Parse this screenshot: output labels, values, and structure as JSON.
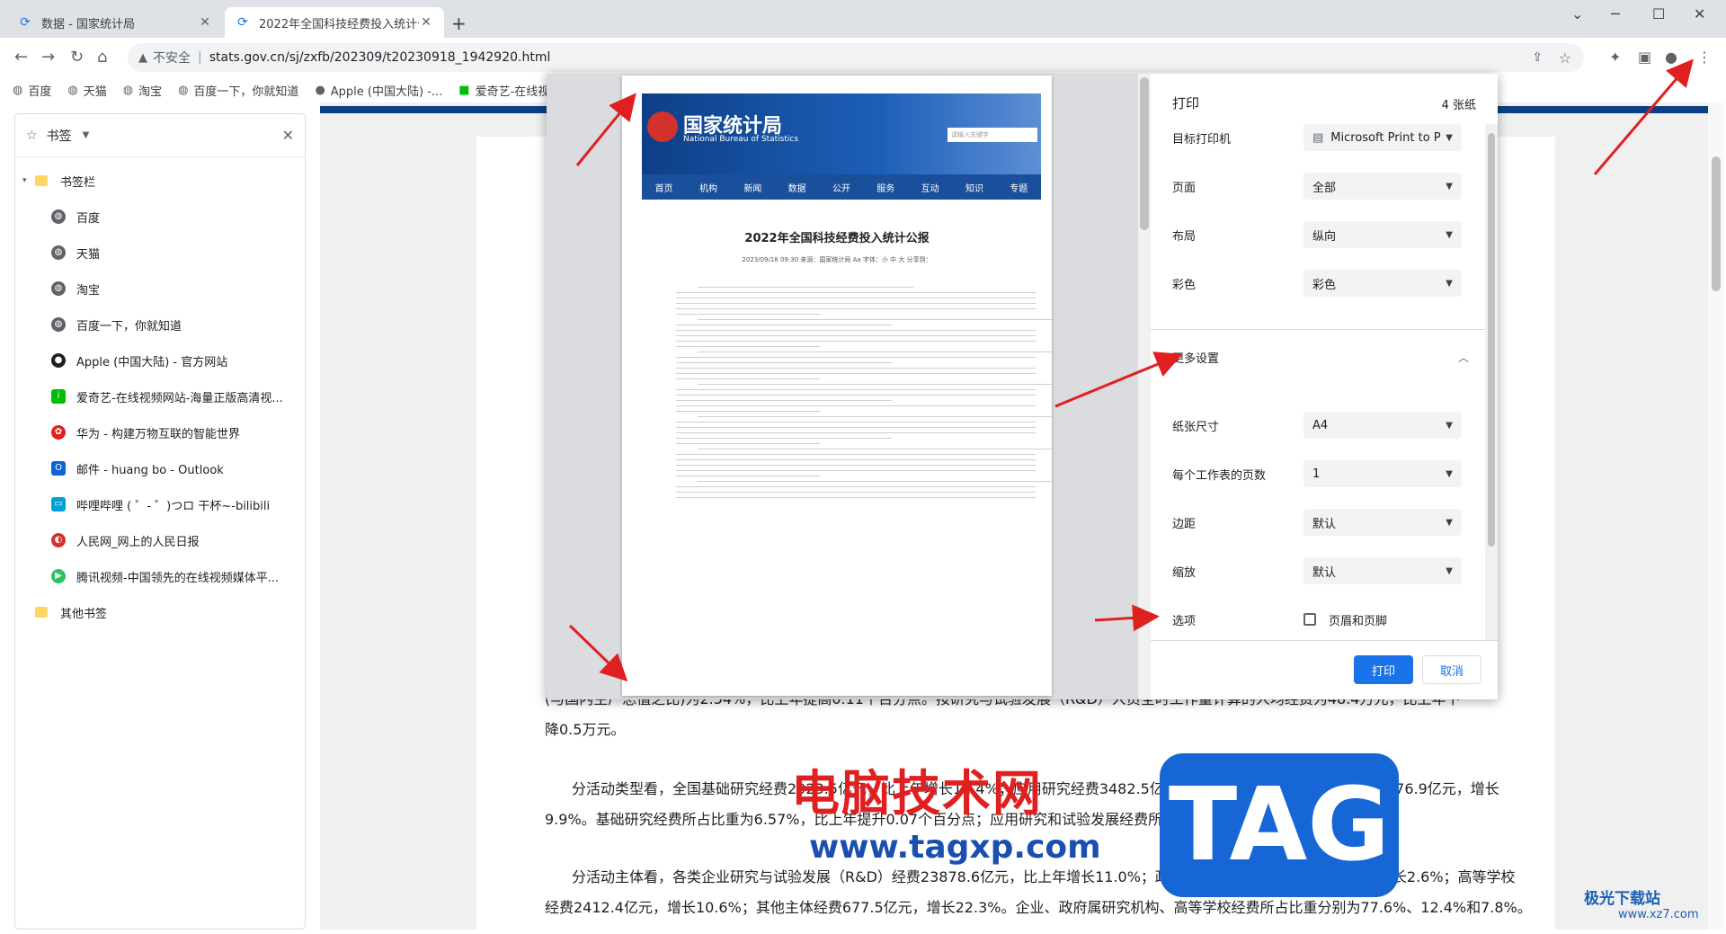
{
  "tabs": [
    {
      "title": "数据 - 国家统计局",
      "active": false
    },
    {
      "title": "2022年全国科技经费投入统计公",
      "active": true
    }
  ],
  "address": {
    "security": "不安全",
    "url": "stats.gov.cn/sj/zxfb/202309/t20230918_1942920.html"
  },
  "bookmarks_bar": [
    "百度",
    "天猫",
    "淘宝",
    "百度一下，你就知道",
    "Apple (中国大陆) -...",
    "爱奇艺-在线视"
  ],
  "side_panel": {
    "title": "书签",
    "root": "书签栏",
    "items": [
      {
        "label": "百度",
        "icon": "globe-icon",
        "color": "#5f6368"
      },
      {
        "label": "天猫",
        "icon": "globe-icon",
        "color": "#5f6368"
      },
      {
        "label": "淘宝",
        "icon": "globe-icon",
        "color": "#5f6368"
      },
      {
        "label": "百度一下，你就知道",
        "icon": "globe-icon",
        "color": "#5f6368"
      },
      {
        "label": "Apple (中国大陆) - 官方网站",
        "icon": "apple-icon",
        "color": "#202124"
      },
      {
        "label": "爱奇艺-在线视频网站-海量正版高清视...",
        "icon": "iqiyi-icon",
        "color": "#00be06"
      },
      {
        "label": "华为 - 构建万物互联的智能世界",
        "icon": "huawei-icon",
        "color": "#e02020"
      },
      {
        "label": "邮件 - huang bo - Outlook",
        "icon": "outlook-icon",
        "color": "#0a64d2"
      },
      {
        "label": "哔哩哔哩 ( ゜- ゜)つロ 干杯~-bilibili",
        "icon": "bilibili-icon",
        "color": "#00a1d6"
      },
      {
        "label": "人民网_网上的人民日报",
        "icon": "people-icon",
        "color": "#d4302c"
      },
      {
        "label": "腾讯视频-中国领先的在线视频媒体平...",
        "icon": "tencent-video-icon",
        "color": "#2cc35c"
      }
    ],
    "other": "其他书签"
  },
  "page_text": [
    "(与国内生产总值之比)为2.54%，比上年提高0.11个百分点。按研究与试验发展（R&D）人员全时工作量计算的人均经费为48.4万元，比上年下",
    "降0.5万元。",
    "分活动类型看，全国基础研究经费2023.5亿元，比上年增长11.4%；应用研究经费3482.5亿元，增长10.7%；试验发展经费22276.9亿元，增长",
    "9.9%。基础研究经费所占比重为6.57%，比上年提升0.07个百分点；应用研究和试验发展经费所占比重分别为11.3%和82.1%。",
    "分活动主体看，各类企业研究与试验发展（R&D）经费23878.6亿元，比上年增长11.0%；政府属研究机构经费3814.4亿元，增长2.6%；高等学校",
    "经费2412.4亿元，增长10.6%；其他主体经费677.5亿元，增长22.3%。企业、政府属研究机构、高等学校经费所占比重分别为77.6%、12.4%和7.8%。"
  ],
  "preview": {
    "site_name": "国家统计局",
    "site_name_en": "National Bureau of Statistics",
    "search_placeholder": "请输入关键字",
    "nav": [
      "首页",
      "机构",
      "新闻",
      "数据",
      "公开",
      "服务",
      "互动",
      "知识",
      "专题"
    ],
    "title": "2022年全国科技经费投入统计公报",
    "meta": "2023/09/18 09:30    来源：国家统计局    Aa  字体：小  中  大    分享到："
  },
  "print": {
    "header": "打印",
    "sheets": "4 张纸",
    "rows": [
      {
        "key": "目标打印机",
        "value": "Microsoft Print to P"
      },
      {
        "key": "页面",
        "value": "全部"
      },
      {
        "key": "布局",
        "value": "纵向"
      },
      {
        "key": "彩色",
        "value": "彩色"
      }
    ],
    "more_settings": "更多设置",
    "more_rows": [
      {
        "key": "纸张尺寸",
        "value": "A4"
      },
      {
        "key": "每个工作表的页数",
        "value": "1"
      },
      {
        "key": "边距",
        "value": "默认"
      },
      {
        "key": "缩放",
        "value": "默认"
      }
    ],
    "options_label": "选项",
    "header_footer": "页眉和页脚",
    "print_btn": "打印",
    "cancel_btn": "取消"
  },
  "watermark": {
    "text": "电脑技术网",
    "url": "www.tagxp.com",
    "tag": "TAG",
    "logo": "极光下载站",
    "logo_url": "www.xz7.com"
  },
  "colors": {
    "accent": "#1a73e8",
    "arrow": "#e02020"
  }
}
